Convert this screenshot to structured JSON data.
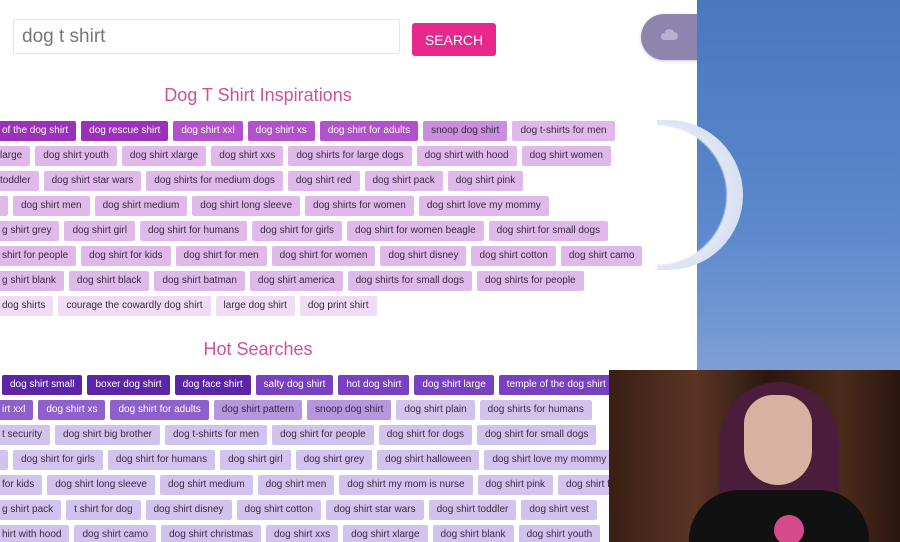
{
  "search": {
    "value": "dog t shirt",
    "button_label": "SEARCH"
  },
  "colors": {
    "accent": "#e6288c",
    "heading": "#c9529a",
    "inspiration_shades": [
      "#9b31ba",
      "#b251cc",
      "#c98fdc",
      "#dfb9ea",
      "#f0dcf4"
    ],
    "hot_shades": [
      "#5b25a7",
      "#7a40c2",
      "#8f60cd",
      "#b596df",
      "#d2c3ee"
    ]
  },
  "inspirations": {
    "title": "Dog T Shirt Inspirations",
    "rows": [
      [
        {
          "t": "of the dog shirt",
          "s": 0
        },
        {
          "t": "dog rescue shirt",
          "s": 0
        },
        {
          "t": "dog shirt xxl",
          "s": 1
        },
        {
          "t": "dog shirt xs",
          "s": 1
        },
        {
          "t": "dog shirt for adults",
          "s": 1
        },
        {
          "t": "snoop dog shirt",
          "s": 2
        },
        {
          "t": "dog t-shirts for men",
          "s": 3
        }
      ],
      [
        {
          "t": "large",
          "s": 3
        },
        {
          "t": "dog shirt youth",
          "s": 3
        },
        {
          "t": "dog shirt xlarge",
          "s": 3
        },
        {
          "t": "dog shirt xxs",
          "s": 3
        },
        {
          "t": "dog shirts for large dogs",
          "s": 3
        },
        {
          "t": "dog shirt with hood",
          "s": 3
        },
        {
          "t": "dog shirt women",
          "s": 3
        }
      ],
      [
        {
          "t": "toddler",
          "s": 3
        },
        {
          "t": "dog shirt star wars",
          "s": 3
        },
        {
          "t": "dog shirts for medium dogs",
          "s": 3
        },
        {
          "t": "dog shirt red",
          "s": 3
        },
        {
          "t": "dog shirt pack",
          "s": 3
        },
        {
          "t": "dog shirt pink",
          "s": 3
        }
      ],
      [
        {
          "t": "",
          "s": 3
        },
        {
          "t": "dog shirt men",
          "s": 3
        },
        {
          "t": "dog shirt medium",
          "s": 3
        },
        {
          "t": "dog shirt long sleeve",
          "s": 3
        },
        {
          "t": "dog shirts for women",
          "s": 3
        },
        {
          "t": "dog shirt love my mommy",
          "s": 3
        }
      ],
      [
        {
          "t": "g shirt grey",
          "s": 3
        },
        {
          "t": "dog shirt girl",
          "s": 3
        },
        {
          "t": "dog shirt for humans",
          "s": 3
        },
        {
          "t": "dog shirt for girls",
          "s": 3
        },
        {
          "t": "dog shirt for women beagle",
          "s": 3
        },
        {
          "t": "dog shirt for small dogs",
          "s": 3
        }
      ],
      [
        {
          "t": "shirt for people",
          "s": 3
        },
        {
          "t": "dog shirt for kids",
          "s": 3
        },
        {
          "t": "dog shirt for men",
          "s": 3
        },
        {
          "t": "dog shirt for women",
          "s": 3
        },
        {
          "t": "dog shirt disney",
          "s": 3
        },
        {
          "t": "dog shirt cotton",
          "s": 3
        },
        {
          "t": "dog shirt camo",
          "s": 3
        }
      ],
      [
        {
          "t": "g shirt blank",
          "s": 3
        },
        {
          "t": "dog shirt black",
          "s": 3
        },
        {
          "t": "dog shirt batman",
          "s": 3
        },
        {
          "t": "dog shirt america",
          "s": 3
        },
        {
          "t": "dog shirts for small dogs",
          "s": 3
        },
        {
          "t": "dog shirts for people",
          "s": 3
        }
      ],
      [
        {
          "t": "dog shirts",
          "s": 4
        },
        {
          "t": "courage the cowardly dog shirt",
          "s": 4
        },
        {
          "t": "large dog shirt",
          "s": 4
        },
        {
          "t": "dog print shirt",
          "s": 4
        }
      ]
    ]
  },
  "hot_searches": {
    "title": "Hot Searches",
    "rows": [
      [
        {
          "t": "dog shirt small",
          "s": 0
        },
        {
          "t": "boxer dog shirt",
          "s": 0
        },
        {
          "t": "dog face shirt",
          "s": 0
        },
        {
          "t": "salty dog shirt",
          "s": 1
        },
        {
          "t": "hot dog shirt",
          "s": 1
        },
        {
          "t": "dog shirt large",
          "s": 1
        },
        {
          "t": "temple of the dog shirt",
          "s": 1
        }
      ],
      [
        {
          "t": "irt xxl",
          "s": 2
        },
        {
          "t": "dog shirt xs",
          "s": 2
        },
        {
          "t": "dog shirt for adults",
          "s": 2
        },
        {
          "t": "dog shirt pattern",
          "s": 3
        },
        {
          "t": "snoop dog shirt",
          "s": 3
        },
        {
          "t": "dog shirt plain",
          "s": 4
        },
        {
          "t": "dog shirts for humans",
          "s": 4
        }
      ],
      [
        {
          "t": "t security",
          "s": 4
        },
        {
          "t": "dog shirt big brother",
          "s": 4
        },
        {
          "t": "dog t-shirts for men",
          "s": 4
        },
        {
          "t": "dog shirt for people",
          "s": 4
        },
        {
          "t": "dog shirt for dogs",
          "s": 4
        },
        {
          "t": "dog shirt for small dogs",
          "s": 4
        }
      ],
      [
        {
          "t": "",
          "s": 4
        },
        {
          "t": "dog shirt for girls",
          "s": 4
        },
        {
          "t": "dog shirt for humans",
          "s": 4
        },
        {
          "t": "dog shirt girl",
          "s": 4
        },
        {
          "t": "dog shirt grey",
          "s": 4
        },
        {
          "t": "dog shirt halloween",
          "s": 4
        },
        {
          "t": "dog shirt love my mommy",
          "s": 4
        }
      ],
      [
        {
          "t": "for kids",
          "s": 4
        },
        {
          "t": "dog shirt long sleeve",
          "s": 4
        },
        {
          "t": "dog shirt medium",
          "s": 4
        },
        {
          "t": "dog shirt men",
          "s": 4
        },
        {
          "t": "dog shirt my mom is nurse",
          "s": 4
        },
        {
          "t": "dog shirt pink",
          "s": 4
        },
        {
          "t": "dog shirt for",
          "s": 4
        }
      ],
      [
        {
          "t": "g shirt pack",
          "s": 4
        },
        {
          "t": "t shirt for dog",
          "s": 4
        },
        {
          "t": "dog shirt disney",
          "s": 4
        },
        {
          "t": "dog shirt cotton",
          "s": 4
        },
        {
          "t": "dog shirt star wars",
          "s": 4
        },
        {
          "t": "dog shirt toddler",
          "s": 4
        },
        {
          "t": "dog shirt vest",
          "s": 4
        }
      ],
      [
        {
          "t": "hirt with hood",
          "s": 4
        },
        {
          "t": "dog shirt camo",
          "s": 4
        },
        {
          "t": "dog shirt christmas",
          "s": 4
        },
        {
          "t": "dog shirt xxs",
          "s": 4
        },
        {
          "t": "dog shirt xlarge",
          "s": 4
        },
        {
          "t": "dog shirt blank",
          "s": 4
        },
        {
          "t": "dog shirt youth",
          "s": 4
        }
      ]
    ]
  },
  "icons": {
    "cloud": "cloud-icon",
    "cursor": "hand-pointer-icon"
  }
}
